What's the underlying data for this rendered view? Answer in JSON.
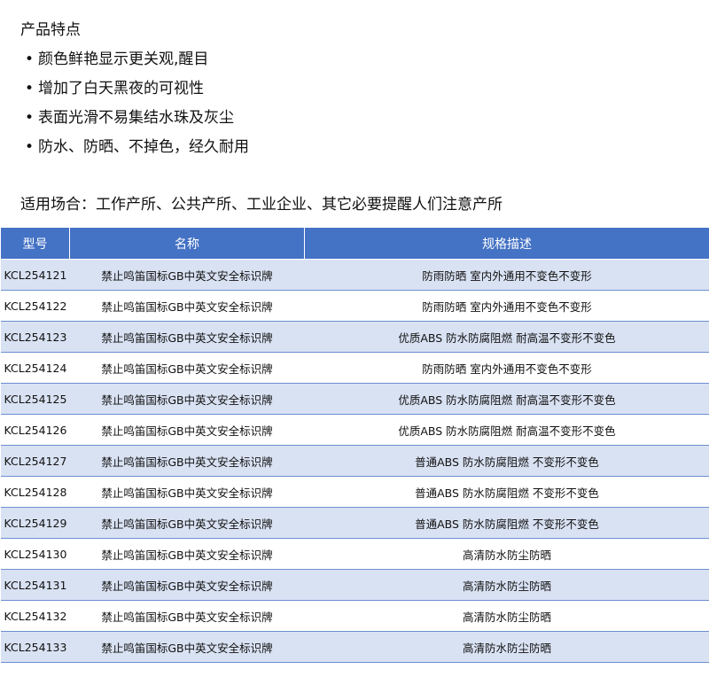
{
  "features": {
    "heading": "产品特点",
    "bullet": "•",
    "items": [
      "颜色鲜艳显示更关观,醒目",
      "增加了白天黑夜的可视性",
      "表面光滑不易集结水珠及灰尘",
      "防水、防晒、不掉色，经久耐用"
    ]
  },
  "usage": "适用场合：工作产所、公共产所、工业企业、其它必要提醒人们注意产所",
  "table": {
    "headers": [
      "型号",
      "名称",
      "规格描述"
    ],
    "rows": [
      [
        "KCL254121",
        "禁止鸣笛国标GB中英文安全标识牌",
        "防雨防晒 室内外通用不变色不变形"
      ],
      [
        "KCL254122",
        "禁止鸣笛国标GB中英文安全标识牌",
        "防雨防晒 室内外通用不变色不变形"
      ],
      [
        "KCL254123",
        "禁止鸣笛国标GB中英文安全标识牌",
        "优质ABS 防水防腐阻燃 耐高温不变形不变色"
      ],
      [
        "KCL254124",
        "禁止鸣笛国标GB中英文安全标识牌",
        "防雨防晒 室内外通用不变色不变形"
      ],
      [
        "KCL254125",
        "禁止鸣笛国标GB中英文安全标识牌",
        "优质ABS 防水防腐阻燃 耐高温不变形不变色"
      ],
      [
        "KCL254126",
        "禁止鸣笛国标GB中英文安全标识牌",
        "优质ABS 防水防腐阻燃 耐高温不变形不变色"
      ],
      [
        "KCL254127",
        "禁止鸣笛国标GB中英文安全标识牌",
        "普通ABS 防水防腐阻燃 不变形不变色"
      ],
      [
        "KCL254128",
        "禁止鸣笛国标GB中英文安全标识牌",
        "普通ABS 防水防腐阻燃 不变形不变色"
      ],
      [
        "KCL254129",
        "禁止鸣笛国标GB中英文安全标识牌",
        "普通ABS 防水防腐阻燃 不变形不变色"
      ],
      [
        "KCL254130",
        "禁止鸣笛国标GB中英文安全标识牌",
        "高清防水防尘防晒"
      ],
      [
        "KCL254131",
        "禁止鸣笛国标GB中英文安全标识牌",
        "高清防水防尘防晒"
      ],
      [
        "KCL254132",
        "禁止鸣笛国标GB中英文安全标识牌",
        "高清防水防尘防晒"
      ],
      [
        "KCL254133",
        "禁止鸣笛国标GB中英文安全标识牌",
        "高清防水防尘防晒"
      ]
    ]
  },
  "colors": {
    "header_bg": "#4472c4",
    "stripe_bg": "#d9e2f3"
  }
}
